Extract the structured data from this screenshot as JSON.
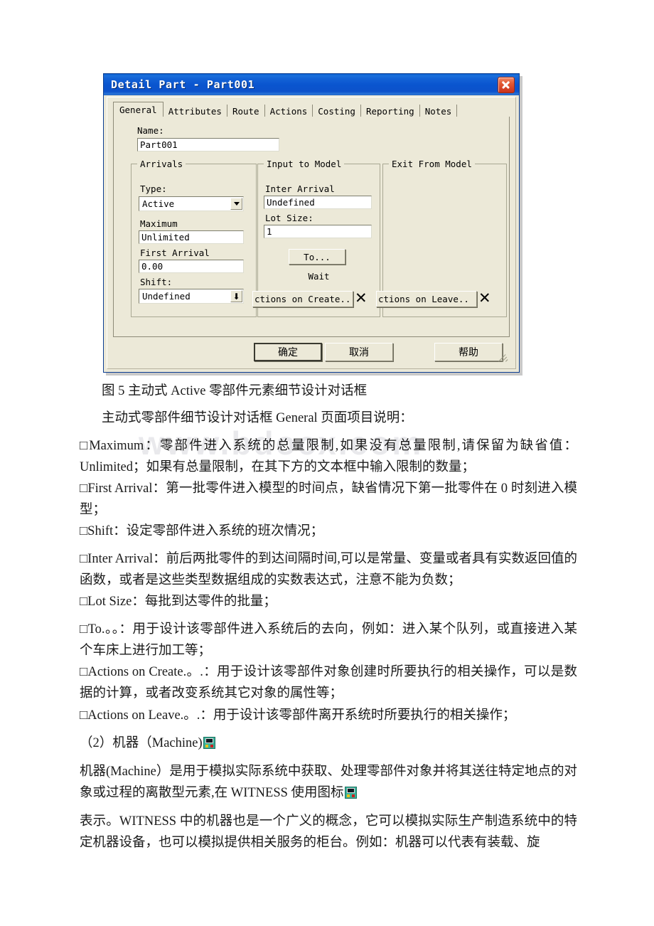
{
  "watermark": {
    "text": "www.bdocx.com"
  },
  "dialog": {
    "title": "Detail Part - Part001",
    "close_label": "x",
    "tabs": [
      {
        "label": "General",
        "active": true
      },
      {
        "label": "Attributes",
        "active": false
      },
      {
        "label": "Route",
        "active": false
      },
      {
        "label": "Actions",
        "active": false
      },
      {
        "label": "Costing",
        "active": false
      },
      {
        "label": "Reporting",
        "active": false
      },
      {
        "label": "Notes",
        "active": false
      }
    ],
    "name_field": {
      "label": "Name:",
      "value": "Part001"
    },
    "arrivals": {
      "title": "Arrivals",
      "type_label": "Type:",
      "type_value": "Active",
      "maximum_label": "Maximum",
      "maximum_value": "Unlimited",
      "first_arrival_label": "First Arrival",
      "first_arrival_value": "0.00",
      "shift_label": "Shift:",
      "shift_value": "Undefined"
    },
    "input_to_model": {
      "title": "Input to Model",
      "inter_arrival_label": "Inter Arrival",
      "inter_arrival_value": "Undefined",
      "lot_size_label": "Lot Size:",
      "lot_size_value": "1",
      "to_button": "To...",
      "wait_label": "Wait",
      "actions_on_create_button": "ctions on Create..",
      "clear_mark": "✕"
    },
    "exit_from_model": {
      "title": "Exit From Model",
      "actions_on_leave_button": "ctions on Leave..",
      "clear_mark": "✕"
    },
    "buttons": {
      "ok": "确定",
      "cancel": "取消",
      "help": "帮助"
    },
    "colors": {
      "titlebar": "#0a55cf",
      "face": "#ece9d8",
      "close": "#c9311b"
    }
  },
  "document": {
    "figure_caption": "图 5 主动式 Active 零部件元素细节设计对话框",
    "intro": "主动式零部件细节设计对话框 General 页面项目说明：",
    "items": [
      "□Maximum：零部件进入系统的总量限制,如果没有总量限制,请保留为缺省值：Unlimited；如果有总量限制，在其下方的文本框中输入限制的数量；",
      "□First Arrival：第一批零件进入模型的时间点，缺省情况下第一批零件在 0 时刻进入模型；",
      "□Shift：设定零部件进入系统的班次情况；",
      "□Inter Arrival：前后两批零件的到达间隔时间,可以是常量、变量或者具有实数返回值的函数，或者是这些类型数据组成的实数表达式，注意不能为负数；",
      "□Lot Size：每批到达零件的批量；",
      "□To.。。：用于设计该零部件进入系统后的去向，例如：进入某个队列，或直接进入某个车床上进行加工等；",
      "□Actions on Create.。.：用于设计该零部件对象创建时所要执行的相关操作，可以是数据的计算，或者改变系统其它对象的属性等；",
      "□Actions on Leave.。.：用于设计该零部件离开系统时所要执行的相关操作；"
    ],
    "machine_heading_pre": "（2）机器（Machine)",
    "machine_para_pre": "机器(Machine）是用于模拟实际系统中获取、处理零部件对象并将其送往特定地点的对象或过程的离散型元素,在 WITNESS 使用图标",
    "machine_para_post": "表示。WITNESS 中的机器也是一个广义的概念，它可以模拟实际生产制造系统中的特定机器设备，也可以模拟提供相关服务的柜台。例如：机器可以代表有装载、旋"
  }
}
